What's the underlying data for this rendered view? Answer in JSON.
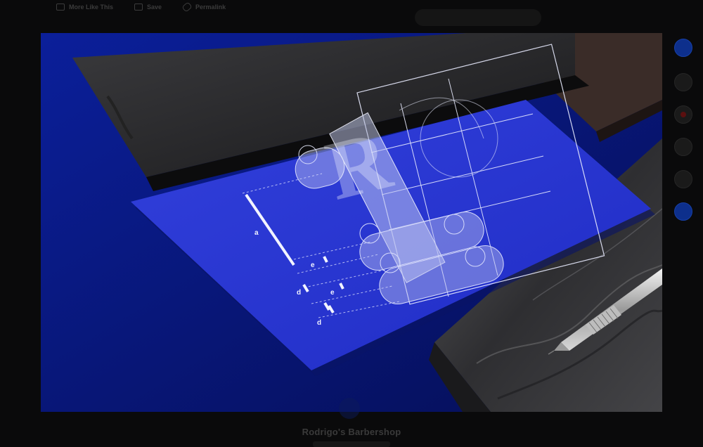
{
  "toolbar": {
    "more_like_this": "More Like This",
    "save": "Save",
    "permalink": "Permalink"
  },
  "project": {
    "title": "Rodrigo's Barbershop"
  },
  "artwork": {
    "letter": "R",
    "dim_a": "a",
    "dim_e1": "e",
    "dim_d1": "d",
    "dim_e2": "e",
    "dim_d2": "d"
  },
  "colors": {
    "card_blue": "#2a36d6",
    "backdrop_blue": "#0a1c8c",
    "line_white": "#e9ecff"
  },
  "icons": {
    "more_like_this": "image-icon",
    "save": "folder-icon",
    "permalink": "link-icon",
    "rail": [
      "phone-icon",
      "mail-icon",
      "pinterest-icon",
      "message-icon",
      "share-icon",
      "appreciate-icon"
    ]
  }
}
